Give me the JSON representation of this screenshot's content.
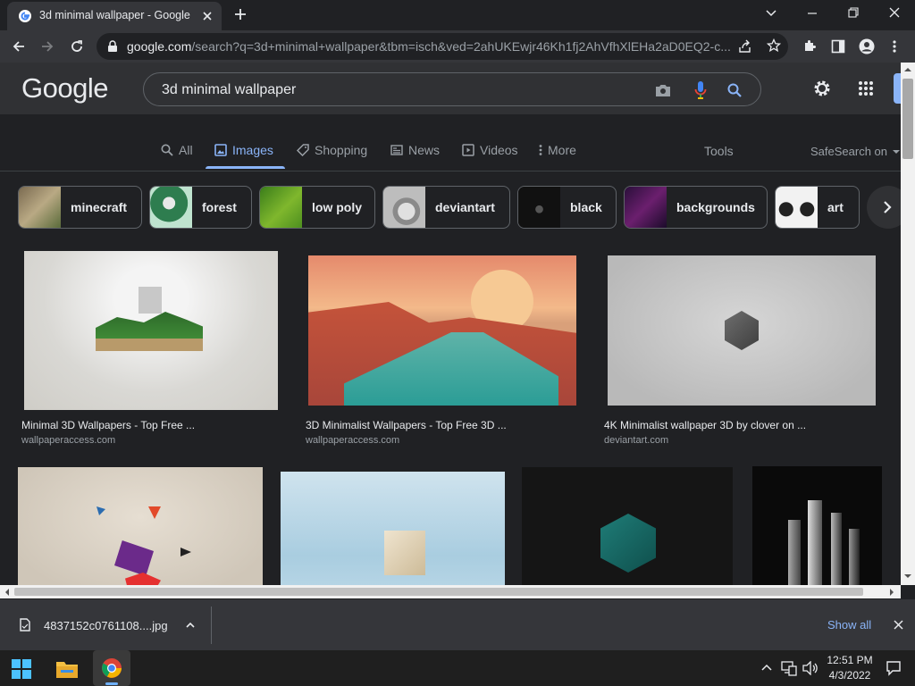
{
  "browser": {
    "tab_title": "3d minimal wallpaper - Google S",
    "url_host": "google.com",
    "url_path": "/search?q=3d+minimal+wallpaper&tbm=isch&ved=2ahUKEwjr46Kh1fj2AhVfhXlEHa2aD0EQ2-c..."
  },
  "google": {
    "logo": "Google",
    "query": "3d minimal wallpaper",
    "tabs": [
      {
        "label": "All"
      },
      {
        "label": "Images"
      },
      {
        "label": "Shopping"
      },
      {
        "label": "News"
      },
      {
        "label": "Videos"
      },
      {
        "label": "More"
      }
    ],
    "tools": "Tools",
    "safesearch": "SafeSearch on"
  },
  "chips": [
    {
      "label": "minecraft"
    },
    {
      "label": "forest"
    },
    {
      "label": "low poly"
    },
    {
      "label": "deviantart"
    },
    {
      "label": "black"
    },
    {
      "label": "backgrounds"
    },
    {
      "label": "art"
    }
  ],
  "results": [
    {
      "caption": "Minimal 3D Wallpapers - Top Free ...",
      "source": "wallpaperaccess.com"
    },
    {
      "caption": "3D Minimalist Wallpapers - Top Free 3D ...",
      "source": "wallpaperaccess.com"
    },
    {
      "caption": "4K Minimalist wallpaper 3D by clover on ...",
      "source": "deviantart.com"
    }
  ],
  "download": {
    "filename": "4837152c0761108....jpg",
    "show_all": "Show all"
  },
  "taskbar": {
    "time": "12:51 PM",
    "date": "4/3/2022"
  },
  "colors": {
    "accent": "#8ab4f8",
    "page_bg": "#202124",
    "header_bg": "#303134"
  }
}
